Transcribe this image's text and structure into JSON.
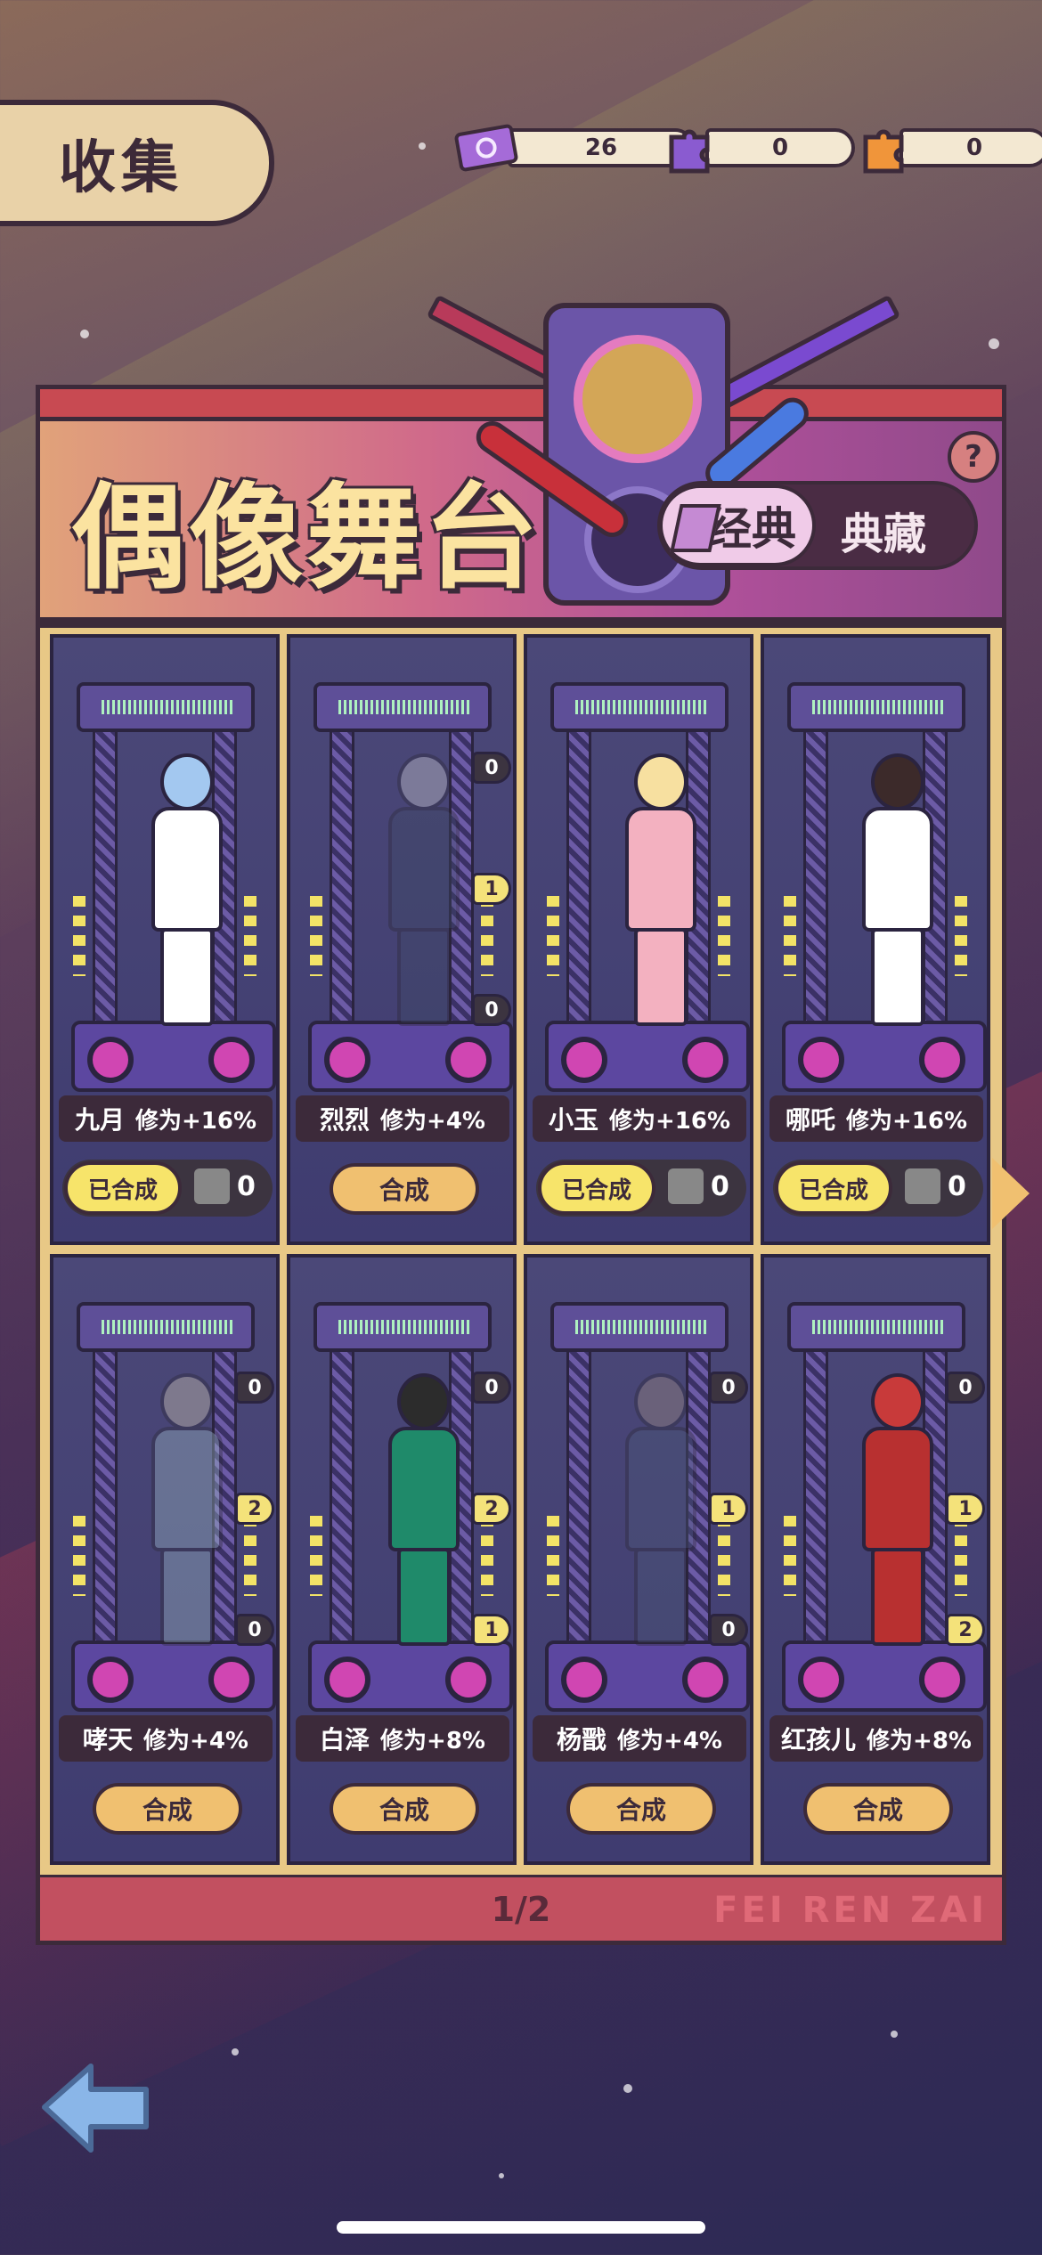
{
  "header": {
    "title": "收集"
  },
  "currencies": [
    {
      "icon": "ticket-icon",
      "value": "26",
      "color": "#a56bd8"
    },
    {
      "icon": "purple-puzzle-icon",
      "value": "0",
      "color": "#8a5bd0"
    },
    {
      "icon": "orange-puzzle-icon",
      "value": "0",
      "color": "#f0953a"
    }
  ],
  "banner": {
    "title": "偶像舞台",
    "tab_classic": "经典",
    "tab_collection": "典藏",
    "help": "?"
  },
  "cards": [
    {
      "name": "九月",
      "bonus": "修为+16%",
      "state": "done",
      "done_label": "已合成",
      "frag_count": "0",
      "skin": "#a3c8f0",
      "outfit": "#ffffff",
      "ghost": false,
      "frags": []
    },
    {
      "name": "烈烈",
      "bonus": "修为+4%",
      "state": "synth",
      "synth_label": "合成",
      "skin": "#dcdcdc",
      "outfit": "#2d4a8a",
      "ghost": true,
      "frags": [
        {
          "v": "0",
          "yel": false
        },
        {
          "v": "1",
          "yel": true
        },
        {
          "v": "0",
          "yel": false
        }
      ]
    },
    {
      "name": "小玉",
      "bonus": "修为+16%",
      "state": "done",
      "done_label": "已合成",
      "frag_count": "0",
      "skin": "#f7e0a0",
      "outfit": "#f3b1c0",
      "ghost": false,
      "frags": []
    },
    {
      "name": "哪吒",
      "bonus": "修为+16%",
      "state": "done",
      "done_label": "已合成",
      "frag_count": "0",
      "skin": "#3c2a2a",
      "outfit": "#ffffff",
      "ghost": false,
      "frags": []
    },
    {
      "name": "哮天",
      "bonus": "修为+4%",
      "state": "synth",
      "synth_label": "合成",
      "skin": "#f5d98a",
      "outfit": "#7ed0e0",
      "ghost": true,
      "frags": [
        {
          "v": "0",
          "yel": false
        },
        {
          "v": "2",
          "yel": true
        },
        {
          "v": "0",
          "yel": false
        }
      ]
    },
    {
      "name": "白泽",
      "bonus": "修为+8%",
      "state": "synth",
      "synth_label": "合成",
      "skin": "#2c2c2c",
      "outfit": "#1f8a6a",
      "ghost": false,
      "frags": [
        {
          "v": "0",
          "yel": false
        },
        {
          "v": "2",
          "yel": true
        },
        {
          "v": "1",
          "yel": true
        }
      ]
    },
    {
      "name": "杨戬",
      "bonus": "修为+4%",
      "state": "synth",
      "synth_label": "合成",
      "skin": "#c89060",
      "outfit": "#3a5aa8",
      "ghost": true,
      "frags": [
        {
          "v": "0",
          "yel": false
        },
        {
          "v": "1",
          "yel": true
        },
        {
          "v": "0",
          "yel": false
        }
      ]
    },
    {
      "name": "红孩儿",
      "bonus": "修为+8%",
      "state": "synth",
      "synth_label": "合成",
      "skin": "#c83a3a",
      "outfit": "#b83030",
      "ghost": false,
      "frags": [
        {
          "v": "0",
          "yel": false
        },
        {
          "v": "1",
          "yel": true
        },
        {
          "v": "2",
          "yel": true
        }
      ]
    }
  ],
  "pagination": {
    "page": "1/2",
    "watermark": "FEI REN ZAI"
  },
  "nav": {
    "back_icon": "back-arrow-icon",
    "next_icon": "next-page-arrow-icon"
  }
}
